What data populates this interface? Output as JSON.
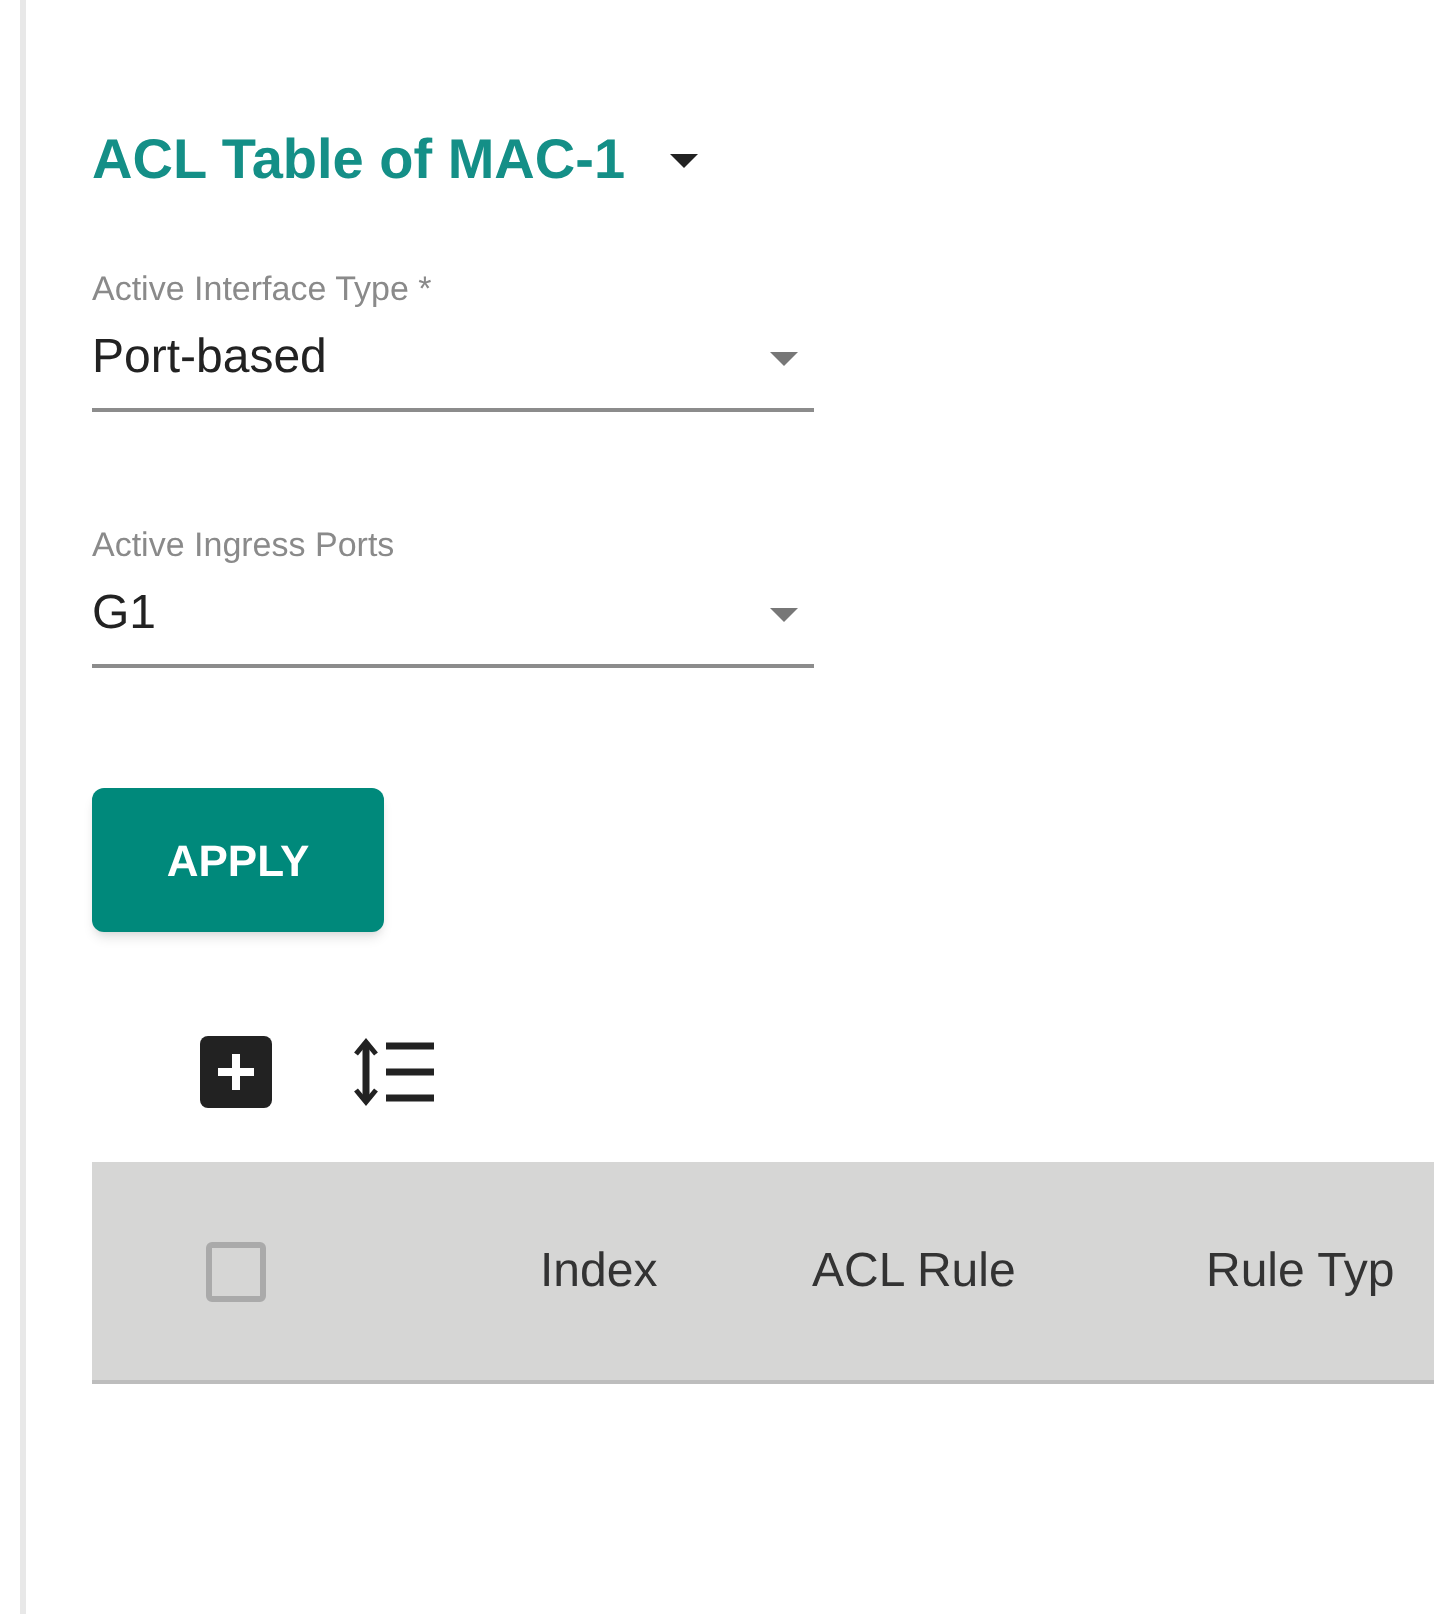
{
  "title": "ACL Table of MAC-1",
  "fields": [
    {
      "label": "Active Interface Type *",
      "value": "Port-based"
    },
    {
      "label": "Active Ingress Ports",
      "value": "G1"
    }
  ],
  "apply_button": "APPLY",
  "table": {
    "select_all": {
      "checked": false
    },
    "columns": [
      "Index",
      "ACL Rule",
      "Rule Typ"
    ]
  }
}
